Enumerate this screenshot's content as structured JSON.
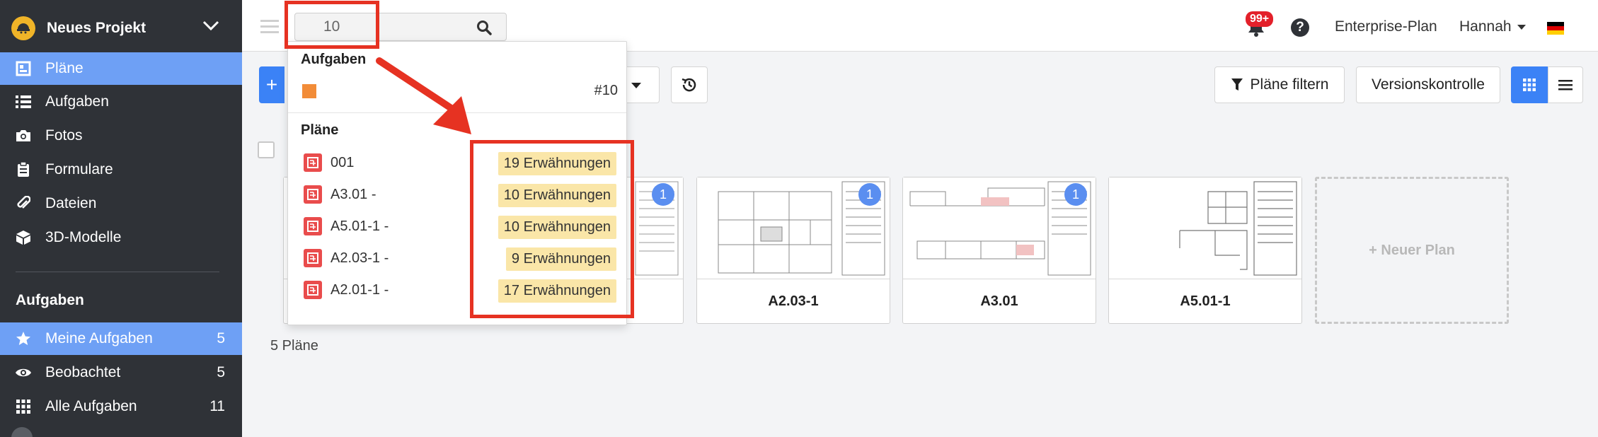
{
  "sidebar": {
    "project_name": "Neues Projekt",
    "items": [
      {
        "label": "Pläne",
        "icon": "plans-icon"
      },
      {
        "label": "Aufgaben",
        "icon": "list-icon"
      },
      {
        "label": "Fotos",
        "icon": "camera-icon"
      },
      {
        "label": "Formulare",
        "icon": "clipboard-icon"
      },
      {
        "label": "Dateien",
        "icon": "paperclip-icon"
      },
      {
        "label": "3D-Modelle",
        "icon": "cube-icon"
      }
    ],
    "section_title": "Aufgaben",
    "task_items": [
      {
        "label": "Meine Aufgaben",
        "count": "5",
        "icon": "star-icon"
      },
      {
        "label": "Beobachtet",
        "count": "5",
        "icon": "eye-icon"
      },
      {
        "label": "Alle Aufgaben",
        "count": "11",
        "icon": "grid-dots-icon"
      }
    ]
  },
  "topbar": {
    "search_value": "10",
    "notification_badge": "99+",
    "help": "?",
    "plan_link": "Enterprise-Plan",
    "user_name": "Hannah"
  },
  "toolbar": {
    "add_label": "+",
    "filter_label": "Pläne filtern",
    "version_label": "Versionskontrolle"
  },
  "dropdown": {
    "tasks_header": "Aufgaben",
    "task_number": "#10",
    "plans_header": "Pläne",
    "plans": [
      {
        "name": "001",
        "mentions": "19 Erwähnungen"
      },
      {
        "name": "A3.01 -",
        "mentions": "10 Erwähnungen"
      },
      {
        "name": "A5.01-1 -",
        "mentions": "10 Erwähnungen"
      },
      {
        "name": "A2.03-1 -",
        "mentions": "9 Erwähnungen"
      },
      {
        "name": "A2.01-1 -",
        "mentions": "17 Erwähnungen"
      }
    ]
  },
  "cards": [
    {
      "name": "",
      "badge": ""
    },
    {
      "name": "",
      "badge": "1"
    },
    {
      "name": "A2.03-1",
      "badge": "1"
    },
    {
      "name": "A3.01",
      "badge": "1"
    },
    {
      "name": "A5.01-1",
      "badge": ""
    }
  ],
  "new_plan_label": "+ Neuer Plan",
  "plan_count": "5 Pläne",
  "colors": {
    "accent": "#3b82f6",
    "sidebar_bg": "#2f3237",
    "active_nav": "#6ea0f5",
    "annotation": "#e63222",
    "mention_bg": "#fae6a8"
  }
}
